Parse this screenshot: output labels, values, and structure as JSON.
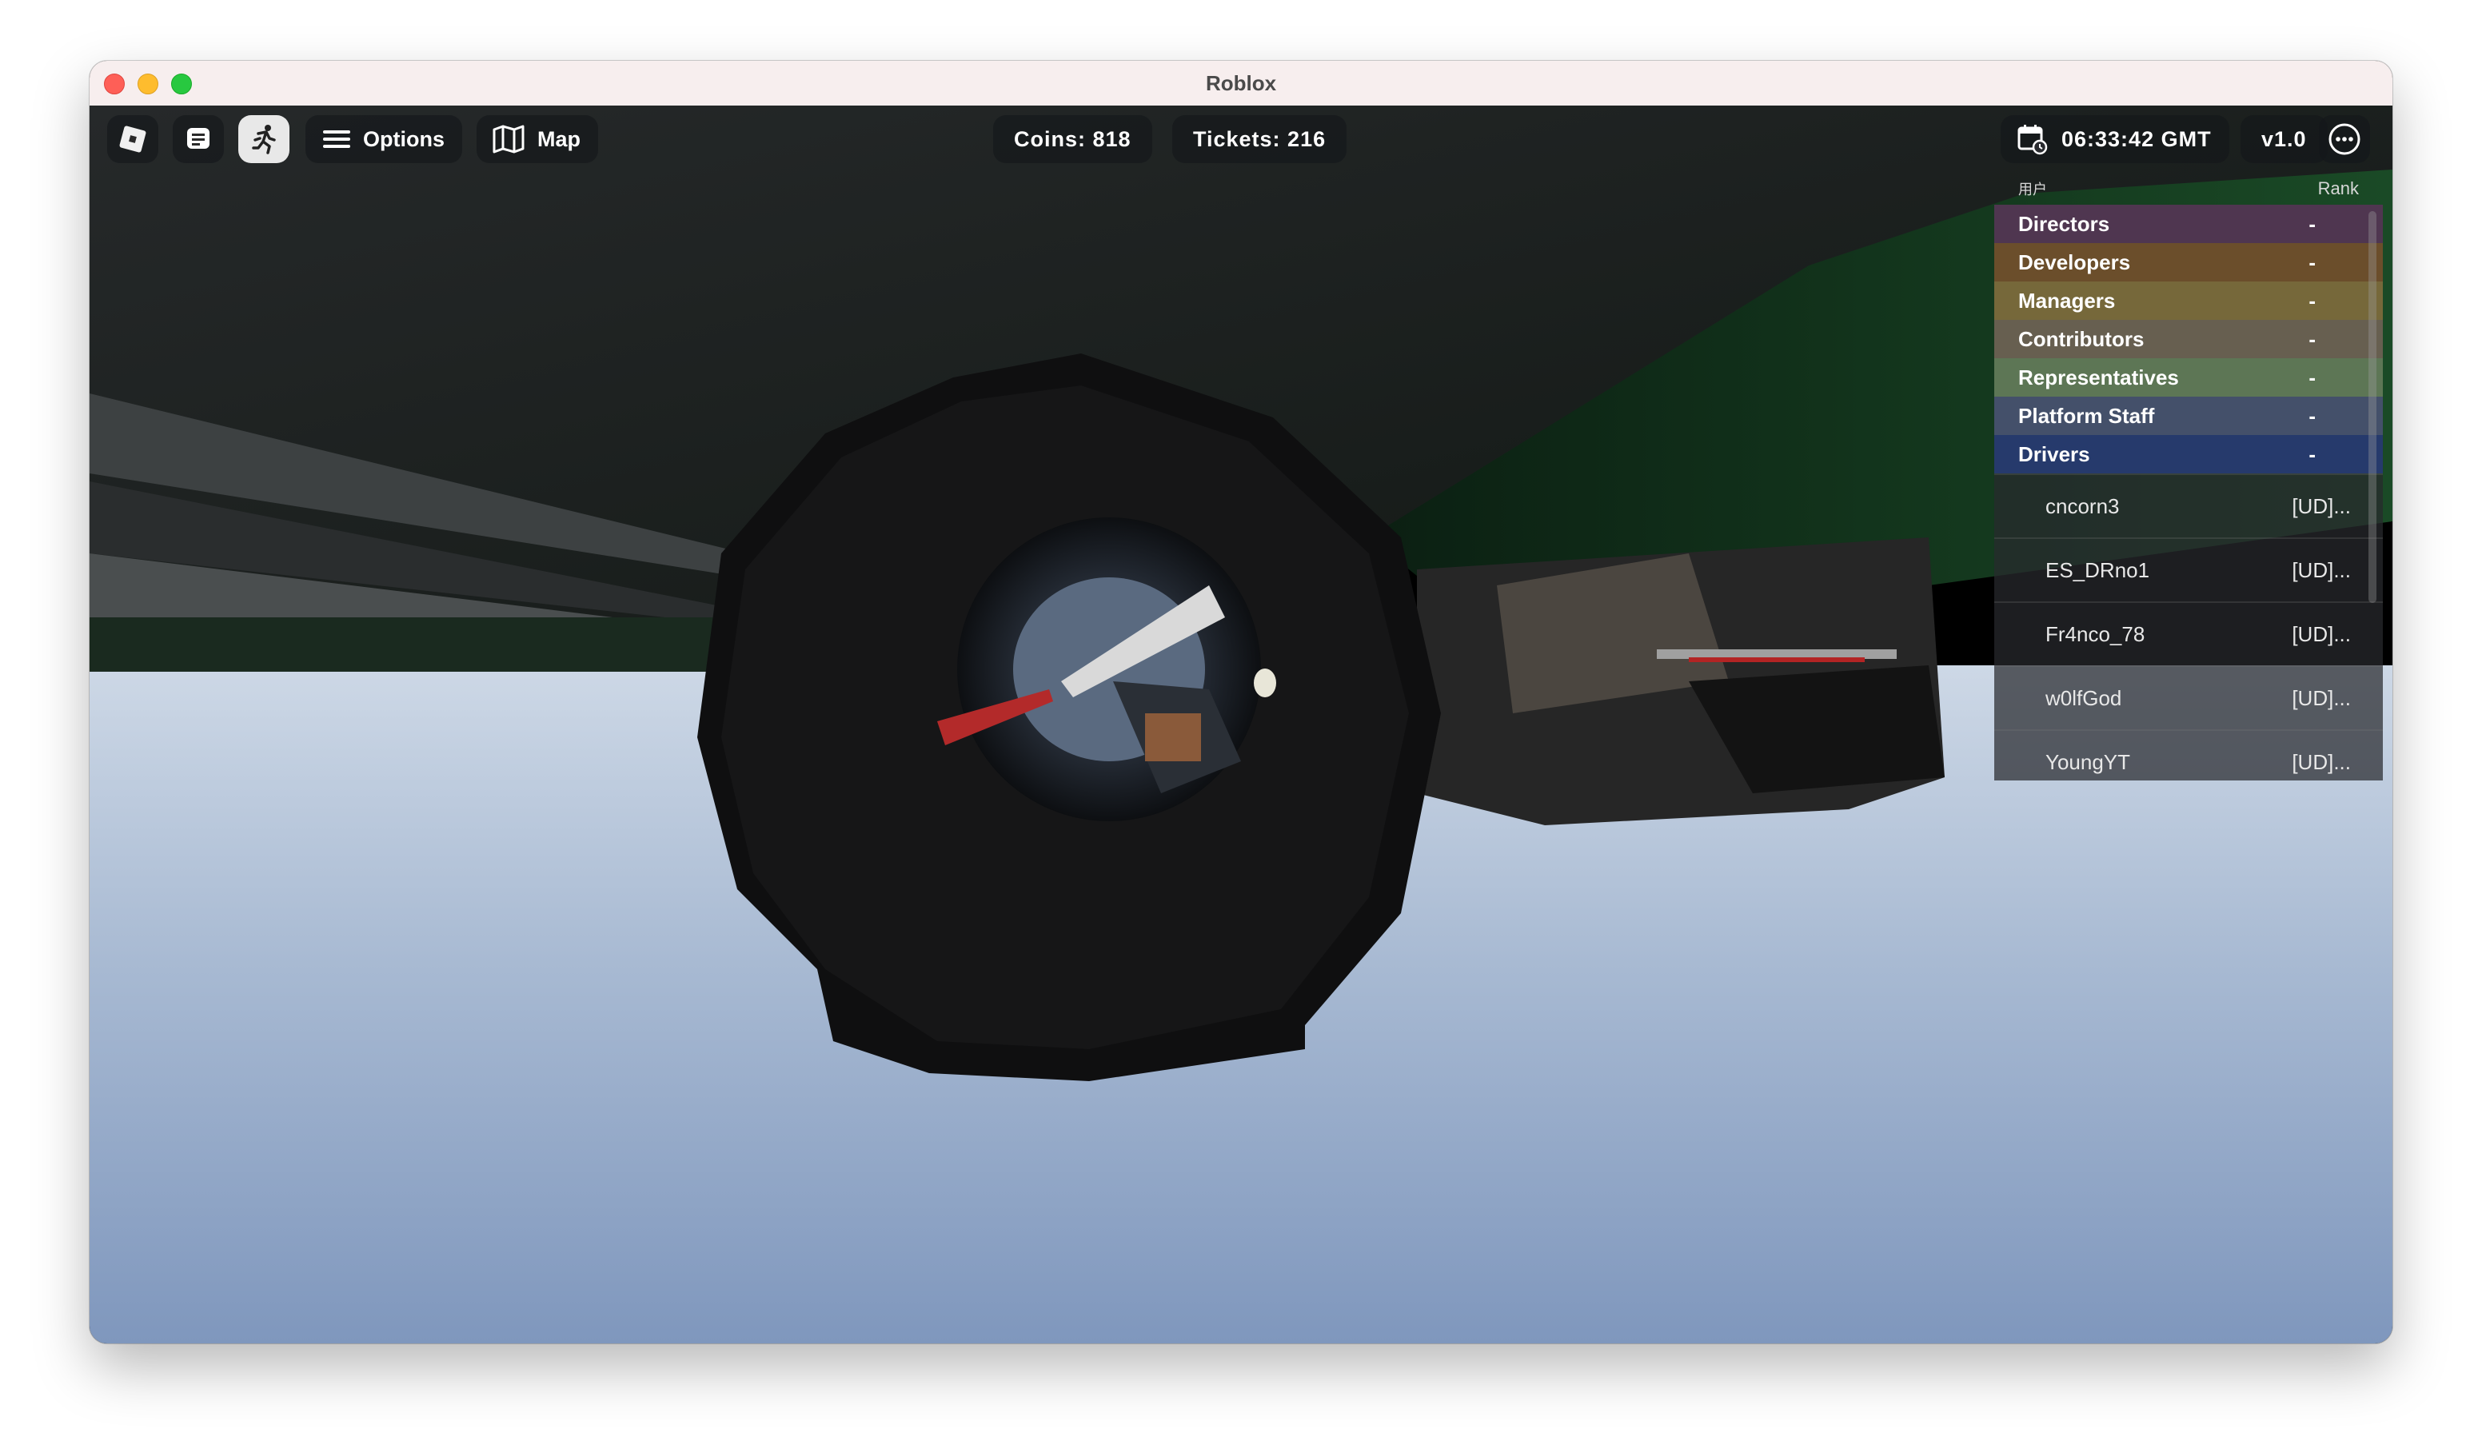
{
  "window": {
    "title": "Roblox"
  },
  "toolbar": {
    "options_label": "Options",
    "map_label": "Map",
    "coins": "Coins: 818",
    "tickets": "Tickets: 216",
    "time": "06:33:42 GMT",
    "version": "v1.0"
  },
  "icons": {
    "roblox": "roblox-logo-icon",
    "chat": "chat-icon",
    "run": "running-person-icon",
    "menu": "hamburger-menu-icon",
    "map": "map-icon",
    "calendar": "calendar-clock-icon",
    "more": "more-ellipsis-icon"
  },
  "leaderboard": {
    "col_user": "用户",
    "col_rank": "Rank",
    "teams": [
      {
        "name": "Directors",
        "value": "-",
        "color": "#4f3650"
      },
      {
        "name": "Developers",
        "value": "-",
        "color": "#6b4e2b"
      },
      {
        "name": "Managers",
        "value": "-",
        "color": "#76683a"
      },
      {
        "name": "Contributors",
        "value": "-",
        "color": "#675f50"
      },
      {
        "name": "Representatives",
        "value": "-",
        "color": "#5d7655"
      },
      {
        "name": "Platform Staff",
        "value": "-",
        "color": "#44506a"
      },
      {
        "name": "Drivers",
        "value": "-",
        "color": "#263a6c"
      }
    ],
    "players": [
      {
        "name": "cncorn3",
        "rank": "[UD]..."
      },
      {
        "name": "ES_DRno1",
        "rank": "[UD]..."
      },
      {
        "name": "Fr4nco_78",
        "rank": "[UD]..."
      },
      {
        "name": "w0lfGod",
        "rank": "[UD]..."
      },
      {
        "name": "YoungYT",
        "rank": "[UD]..."
      }
    ]
  }
}
